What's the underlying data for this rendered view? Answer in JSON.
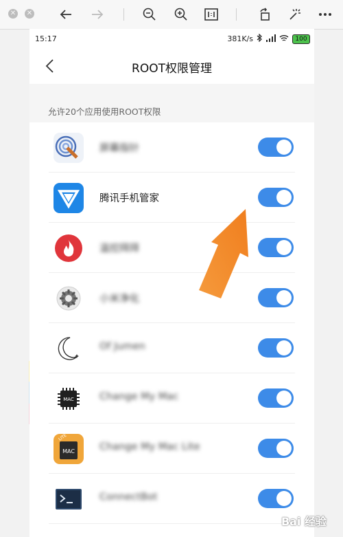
{
  "viewer": {
    "icons": [
      "close-circle-icon",
      "cancel-circle-icon",
      "back-arrow-icon",
      "forward-arrow-icon",
      "zoom-out-icon",
      "zoom-in-icon",
      "actual-size-icon",
      "rotate-icon",
      "magic-wand-icon",
      "more-icon"
    ]
  },
  "status_bar": {
    "time": "15:17",
    "speed": "381K/s",
    "battery": "100"
  },
  "nav": {
    "title": "ROOT权限管理"
  },
  "section": {
    "label": "允许20个应用使用ROOT权限"
  },
  "apps": [
    {
      "name": "屏幕指针",
      "blurred": true,
      "enabled": true,
      "icon": "radar-pointer-icon"
    },
    {
      "name": "腾讯手机管家",
      "blurred": false,
      "enabled": true,
      "icon": "tencent-shield-icon"
    },
    {
      "name": "温控拜拜",
      "blurred": true,
      "enabled": true,
      "icon": "flame-icon"
    },
    {
      "name": "小米净化",
      "blurred": true,
      "enabled": true,
      "icon": "gear-icon"
    },
    {
      "name": "Of Jumen",
      "blurred": true,
      "enabled": true,
      "icon": "moon-icon"
    },
    {
      "name": "Change My Mac",
      "blurred": true,
      "enabled": true,
      "icon": "mac-chip-icon"
    },
    {
      "name": "Change My Mac Lite",
      "blurred": true,
      "enabled": true,
      "icon": "mac-lite-icon"
    },
    {
      "name": "ConnectBot",
      "blurred": true,
      "enabled": true,
      "icon": "terminal-icon"
    }
  ],
  "watermark": "Bai 经验",
  "colors": {
    "toggle_on": "#3d8be8",
    "arrow": "#f28a2a"
  }
}
